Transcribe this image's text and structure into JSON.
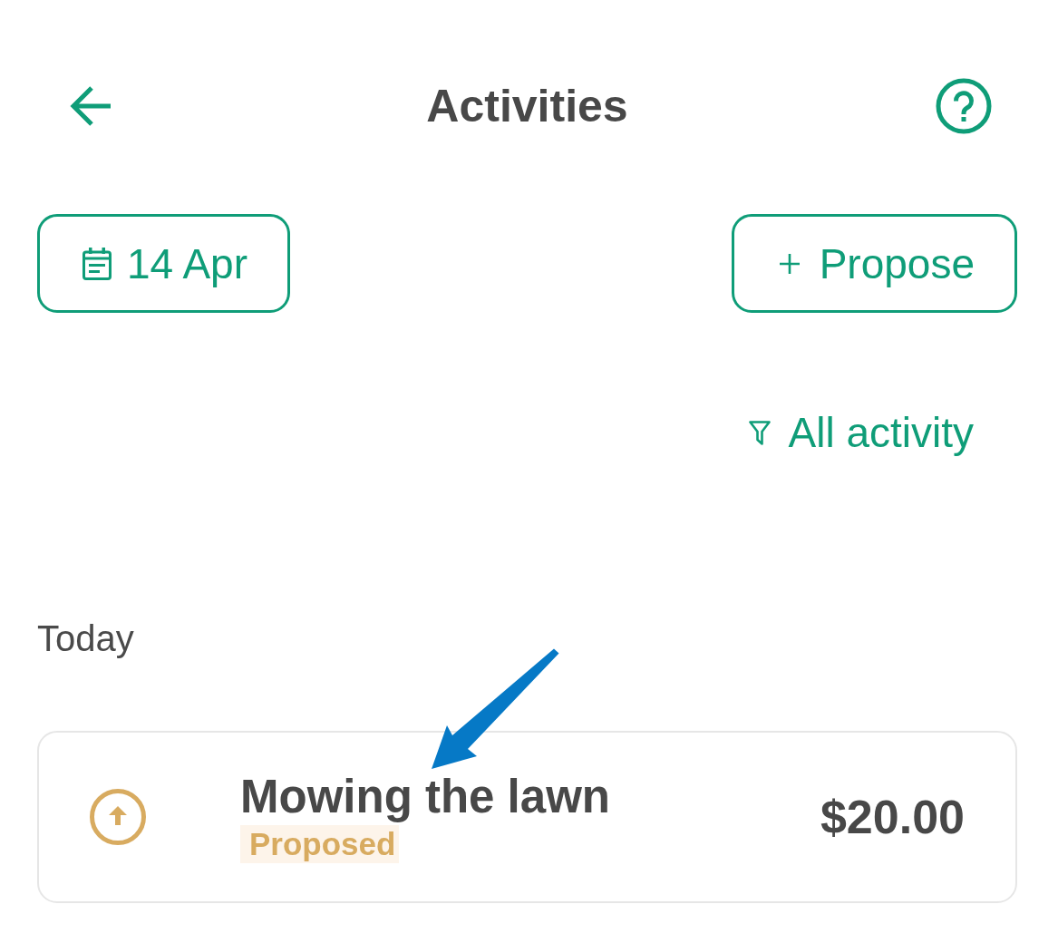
{
  "header": {
    "title": "Activities"
  },
  "toolbar": {
    "date_button": "14 Apr",
    "propose_button": "Propose"
  },
  "filter": {
    "label": "All activity"
  },
  "sections": [
    {
      "heading": "Today",
      "items": [
        {
          "title": "Mowing the lawn",
          "status": "Proposed",
          "kind": "proposed",
          "amount": "$20.00"
        }
      ]
    }
  ]
}
